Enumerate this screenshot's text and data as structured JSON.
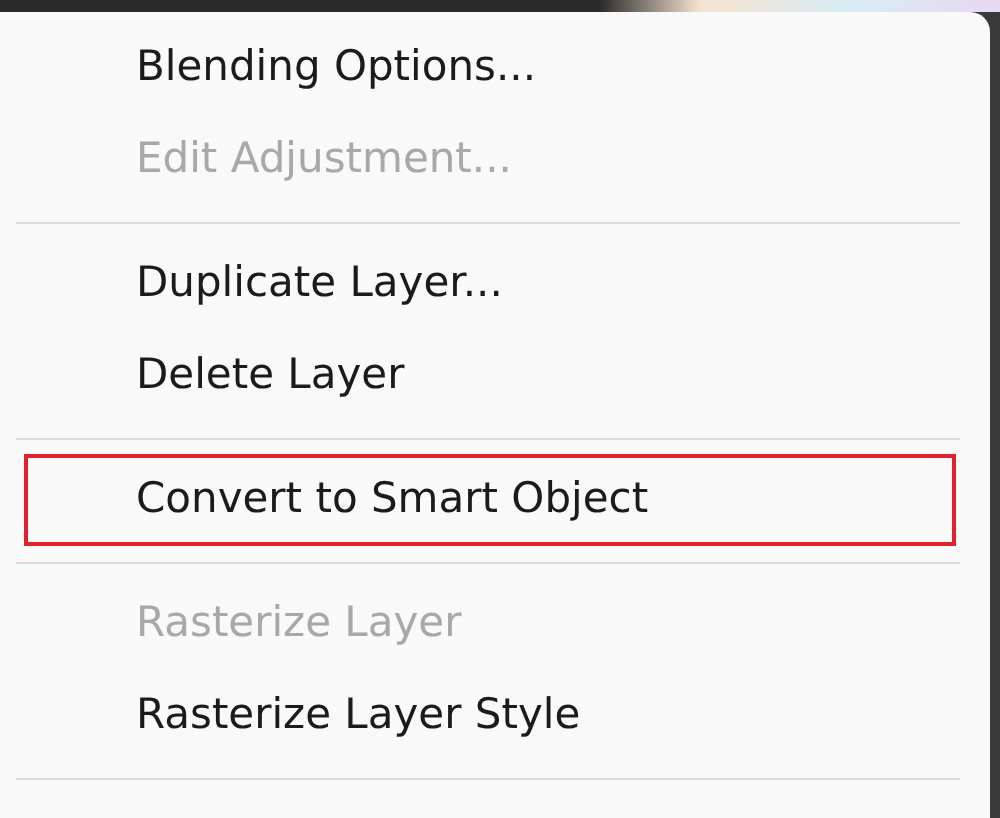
{
  "menu": {
    "items": [
      {
        "kind": "item",
        "label": "Blending Options...",
        "disabled": false,
        "highlighted": false
      },
      {
        "kind": "item",
        "label": "Edit Adjustment...",
        "disabled": true,
        "highlighted": false
      },
      {
        "kind": "separator"
      },
      {
        "kind": "item",
        "label": "Duplicate Layer...",
        "disabled": false,
        "highlighted": false
      },
      {
        "kind": "item",
        "label": "Delete Layer",
        "disabled": false,
        "highlighted": false
      },
      {
        "kind": "separator"
      },
      {
        "kind": "item",
        "label": "Convert to Smart Object",
        "disabled": false,
        "highlighted": true
      },
      {
        "kind": "separator"
      },
      {
        "kind": "item",
        "label": "Rasterize Layer",
        "disabled": true,
        "highlighted": false
      },
      {
        "kind": "item",
        "label": "Rasterize Layer Style",
        "disabled": false,
        "highlighted": false
      },
      {
        "kind": "separator"
      }
    ]
  }
}
